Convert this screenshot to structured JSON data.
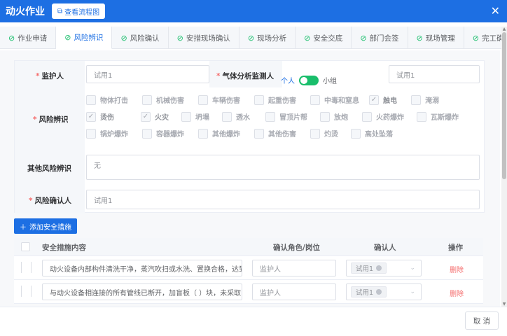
{
  "window": {
    "title": "动火作业",
    "flow_button": "查看流程图"
  },
  "tabs": [
    {
      "label": "作业申请"
    },
    {
      "label": "风险辨识"
    },
    {
      "label": "风险确认"
    },
    {
      "label": "安措现场确认"
    },
    {
      "label": "现场分析"
    },
    {
      "label": "安全交底"
    },
    {
      "label": "部门会签"
    },
    {
      "label": "现场管理"
    },
    {
      "label": "完工确认"
    }
  ],
  "form": {
    "guardian_label": "监护人",
    "guardian_value": "试用1",
    "gas_label": "气体分析监测人",
    "switch_left": "个人",
    "switch_right": "小组",
    "gas_value": "试用1",
    "risk_label": "风险辨识",
    "risks": [
      "物体打击",
      "机械伤害",
      "车辆伤害",
      "起重伤害",
      "中毒和窒息",
      "触电",
      "淹溺",
      "烫伤",
      "火灾",
      "坍塌",
      "透水",
      "冒顶片帮",
      "放炮",
      "火药爆炸",
      "瓦斯爆炸",
      "锅炉爆炸",
      "容器爆炸",
      "其他爆炸",
      "其他伤害",
      "灼烫",
      "高处坠落"
    ],
    "other_label": "其他风险辨识",
    "other_value": "无",
    "confirm_label": "风险确认人",
    "confirm_value": "试用1"
  },
  "add_button": "添加安全措施",
  "table": {
    "headers": [
      "安全措施内容",
      "确认角色/岗位",
      "确认人",
      "操作"
    ],
    "rows": [
      {
        "content": "动火设备内部构件清洗干净，蒸汽吹扫或水洗、置换合格，达到",
        "role": "监护人",
        "person": "试用1",
        "action": "删除"
      },
      {
        "content": "与动火设备相连接的所有管线已断开，加盲板（ ）块，未采取",
        "role": "监护人",
        "person": "试用1",
        "action": "删除"
      }
    ]
  },
  "footer": {
    "cancel": "取 消"
  },
  "colors": {
    "primary": "#1d6fe3",
    "success": "#19be6b",
    "danger": "#f56c6c"
  }
}
